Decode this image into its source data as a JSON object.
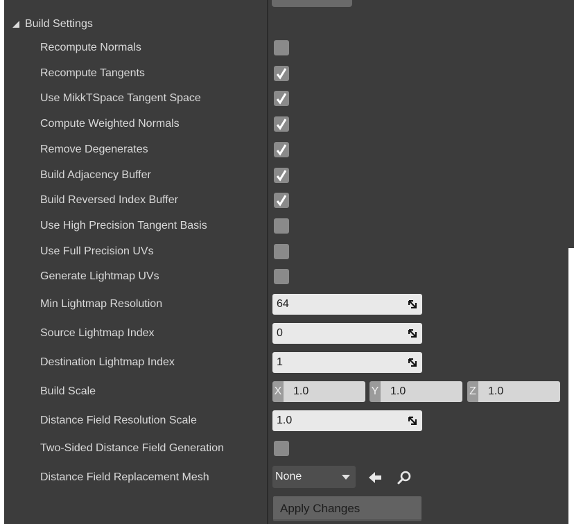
{
  "section": {
    "title": "Build Settings"
  },
  "rows": [
    {
      "label": "Recompute Normals",
      "checked": false
    },
    {
      "label": "Recompute Tangents",
      "checked": true
    },
    {
      "label": "Use MikkTSpace Tangent Space",
      "checked": true
    },
    {
      "label": "Compute Weighted Normals",
      "checked": true
    },
    {
      "label": "Remove Degenerates",
      "checked": true
    },
    {
      "label": "Build Adjacency Buffer",
      "checked": true
    },
    {
      "label": "Build Reversed Index Buffer",
      "checked": true
    },
    {
      "label": "Use High Precision Tangent Basis",
      "checked": false
    },
    {
      "label": "Use Full Precision UVs",
      "checked": false
    },
    {
      "label": "Generate Lightmap UVs",
      "checked": false
    }
  ],
  "min_lightmap": {
    "label": "Min Lightmap Resolution",
    "value": "64"
  },
  "source_lightmap": {
    "label": "Source Lightmap Index",
    "value": "0"
  },
  "dest_lightmap": {
    "label": "Destination Lightmap Index",
    "value": "1"
  },
  "build_scale": {
    "label": "Build Scale",
    "x_tag": "X",
    "x": "1.0",
    "y_tag": "Y",
    "y": "1.0",
    "z_tag": "Z",
    "z": "1.0"
  },
  "df_res": {
    "label": "Distance Field Resolution Scale",
    "value": "1.0"
  },
  "two_sided": {
    "label": "Two-Sided Distance Field Generation",
    "checked": false
  },
  "df_mesh": {
    "label": "Distance Field Replacement Mesh",
    "value": "None"
  },
  "apply": {
    "label": "Apply Changes"
  },
  "icons": {
    "back": "arrow-left-icon",
    "find": "search-icon",
    "resize": "resize-icon"
  },
  "colors": {
    "panel": "#3c3c3c",
    "checkbox": "#8a8a8a",
    "input": "#e9e9e9"
  }
}
